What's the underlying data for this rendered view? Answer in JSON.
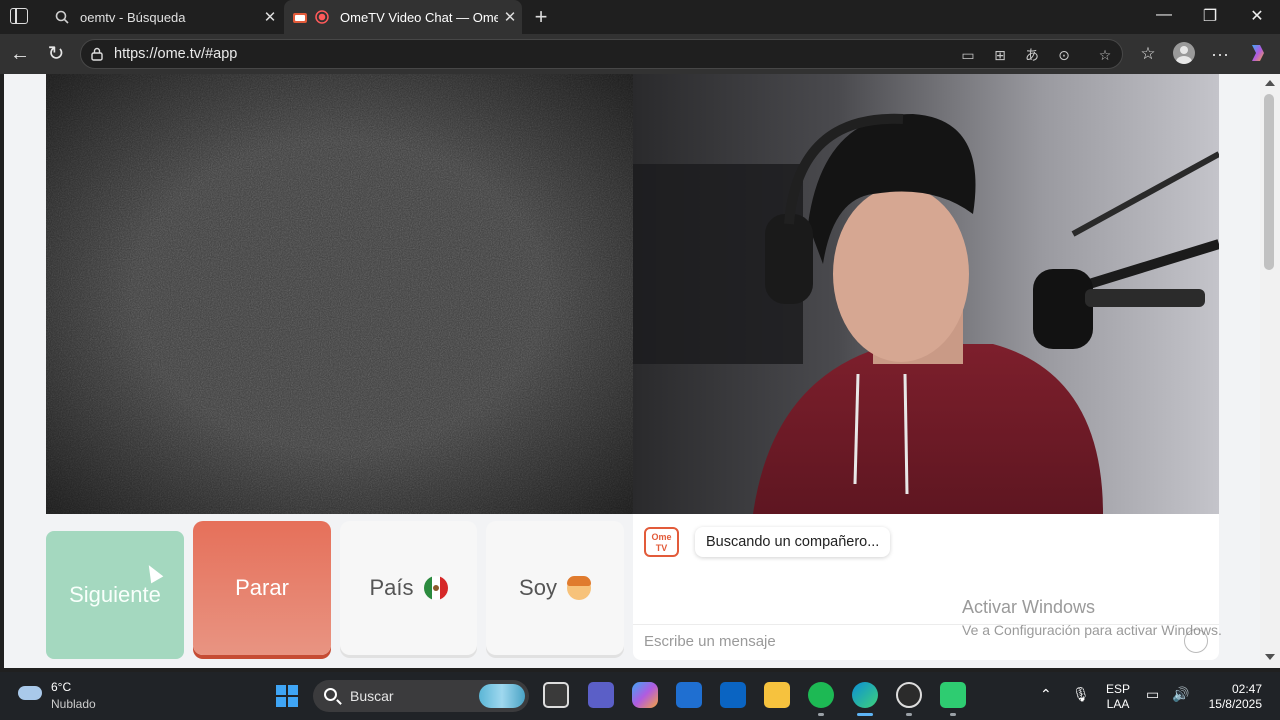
{
  "browser": {
    "tabs": [
      {
        "title": "oemtv - Búsqueda",
        "active": false,
        "icon": "search-favicon"
      },
      {
        "title": "OmeTV Video Chat — Omeg",
        "active": true,
        "icon": "ometv-favicon",
        "recording": true
      }
    ],
    "url": "https://ome.tv/#app",
    "colors": {
      "chrome": "#1f1f1f",
      "toolbar": "#323232"
    }
  },
  "app": {
    "buttons": {
      "next": "Siguiente",
      "stop": "Parar",
      "country": "País",
      "gender": "Soy"
    },
    "country_flag": "mexico-flag",
    "gender_icon": "boy-emoji",
    "chat": {
      "logo_text": "Ome TV",
      "status": "Buscando un compañero...",
      "placeholder": "Escribe un mensaje"
    },
    "colors": {
      "next": "#a4d8bf",
      "stop": "#e6705a",
      "neutral": "#f7f7f7"
    }
  },
  "watermark": {
    "title": "Activar Windows",
    "subtitle": "Ve a Configuración para activar Windows."
  },
  "taskbar": {
    "weather": {
      "temp": "6°C",
      "condition": "Nublado"
    },
    "search_label": "Buscar",
    "language": {
      "line1": "ESP",
      "line2": "LAA"
    },
    "time": "02:47",
    "date": "15/8/2025"
  }
}
